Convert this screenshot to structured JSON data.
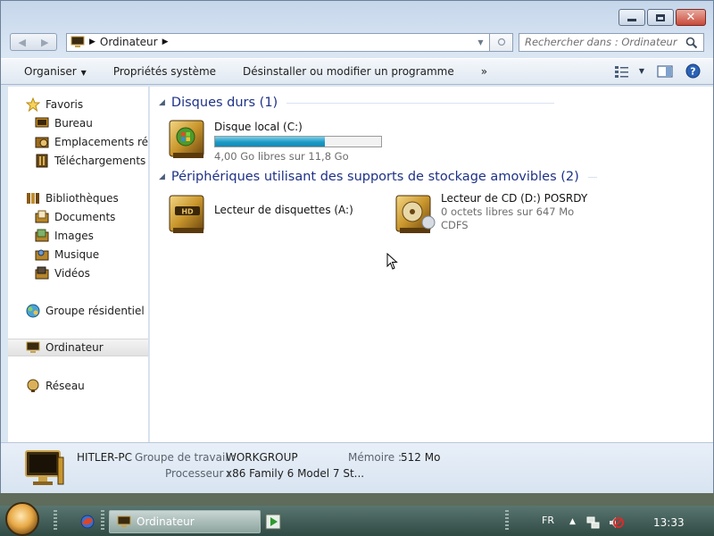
{
  "window": {
    "caption_buttons": {
      "minimize_icon": "minimize-icon",
      "maximize_icon": "maximize-icon",
      "close_icon": "close-icon"
    }
  },
  "address": {
    "crumb": "Ordinateur",
    "icon": "computer-icon"
  },
  "search": {
    "placeholder": "Rechercher dans : Ordinateur"
  },
  "toolbar": {
    "organize": "Organiser",
    "system_properties": "Propriétés système",
    "uninstall": "Désinstaller ou modifier un programme",
    "more": "»"
  },
  "sidebar": {
    "favorites": {
      "label": "Favoris",
      "items": [
        "Bureau",
        "Emplacements récents",
        "Téléchargements"
      ]
    },
    "libraries": {
      "label": "Bibliothèques",
      "items": [
        "Documents",
        "Images",
        "Musique",
        "Vidéos"
      ]
    },
    "homegroup": "Groupe résidentiel",
    "computer": "Ordinateur",
    "network": "Réseau"
  },
  "content": {
    "hard_disks": {
      "header": "Disques durs (1)",
      "drives": [
        {
          "name": "Disque local (C:)",
          "free": "4,00 Go libres sur 11,8 Go",
          "used_fraction": 0.66
        }
      ]
    },
    "removable": {
      "header": "Périphériques utilisant des supports de stockage amovibles (2)",
      "drives": [
        {
          "name": "Lecteur de disquettes (A:)"
        },
        {
          "name": "Lecteur de CD (D:) POSRDY",
          "free": "0 octets libres sur 647 Mo",
          "fs": "CDFS"
        }
      ]
    }
  },
  "details": {
    "computer_name": "HITLER-PC",
    "workgroup_label": "Groupe de travail :",
    "workgroup": "WORKGROUP",
    "memory_label": "Mémoire :",
    "memory": "512 Mo",
    "processor_label": "Processeur :",
    "processor": "x86 Family 6 Model 7 St..."
  },
  "taskbar": {
    "task_label": "Ordinateur",
    "language": "FR",
    "clock": "13:33"
  },
  "colors": {
    "group_header": "#1e3287",
    "progress_fill": "#1c9ac6",
    "window_frame": "#c6d6ea"
  }
}
